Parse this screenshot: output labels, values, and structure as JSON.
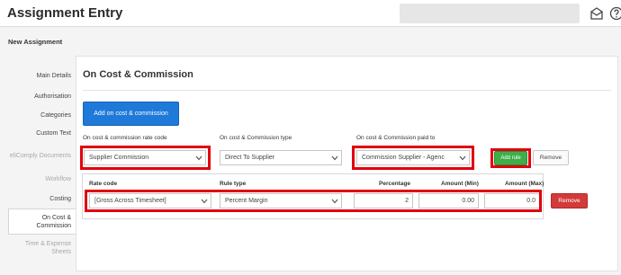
{
  "header": {
    "title": "Assignment Entry",
    "subtitle": "New Assignment"
  },
  "sidebar": {
    "items": [
      {
        "label": "Main Details",
        "state": "normal"
      },
      {
        "label": "Authorisation",
        "state": "normal"
      },
      {
        "label": "Categories",
        "state": "normal"
      },
      {
        "label": "Custom Text",
        "state": "normal"
      },
      {
        "label": "eliComply Documents",
        "state": "disabled"
      },
      {
        "label": "Workflow",
        "state": "disabled"
      },
      {
        "label": "Costing",
        "state": "normal"
      },
      {
        "label": "On Cost & Commission",
        "state": "active"
      },
      {
        "label": "Time & Expense Sheets",
        "state": "disabled"
      }
    ]
  },
  "panel": {
    "title": "On Cost & Commission",
    "add_button": "Add on cost & commission",
    "labels": {
      "rate_code": "On cost & commission rate code",
      "type": "On cost & Commission type",
      "paid_to": "On cost & Commission paid to"
    },
    "values": {
      "rate_code": "Supplier Commission",
      "type": "Direct To Supplier",
      "paid_to": "Commission Supplier - Agenc"
    },
    "add_rule": "Add rule",
    "remove": "Remove",
    "rules_table": {
      "headers": [
        "Rate code",
        "Rule type",
        "Percentage",
        "Amount (Min)",
        "Amount (Max)"
      ],
      "row": {
        "rate_code": "[Gross Across Timesheet]",
        "rule_type": "Percent Margin",
        "percentage": "2",
        "amount_min": "0.00",
        "amount_max": "0.0"
      },
      "remove": "Remove"
    }
  },
  "colors": {
    "primary": "#1e79d9",
    "success": "#3fae49",
    "danger": "#d33a3a",
    "highlight": "#e1000f"
  }
}
